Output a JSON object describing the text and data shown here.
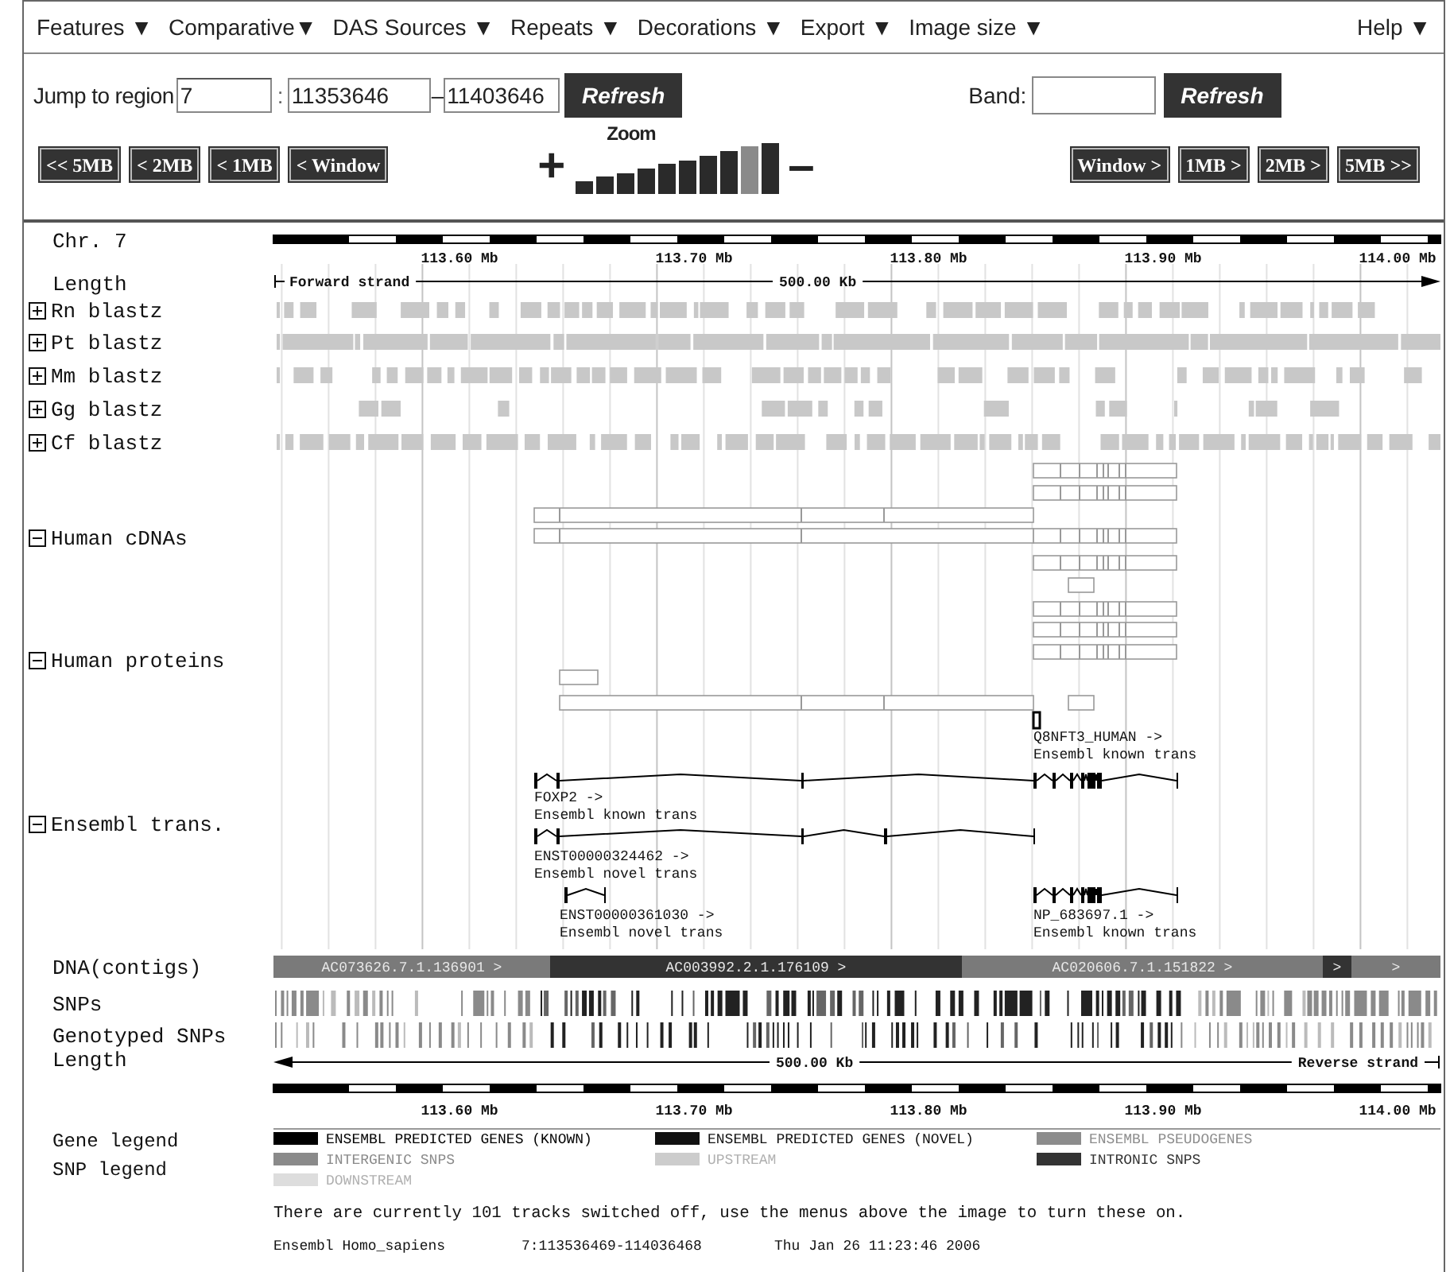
{
  "menus": [
    {
      "label": "Features ▼"
    },
    {
      "label": "Comparative▼"
    },
    {
      "label": "DAS Sources ▼"
    },
    {
      "label": "Repeats ▼"
    },
    {
      "label": "Decorations ▼"
    },
    {
      "label": "Export ▼"
    },
    {
      "label": "Image size ▼"
    }
  ],
  "help_menu": "Help ▼",
  "region": {
    "label": "Jump to region",
    "chromosome": "7",
    "separator": ":",
    "start": "11353646",
    "dash": "–",
    "end": "11403646",
    "button": "Refresh"
  },
  "band": {
    "label": "Band:",
    "button": "Refresh"
  },
  "nav_left": [
    "<< 5MB",
    "< 2MB",
    "< 1MB",
    "< Window"
  ],
  "zoom": {
    "plus": "+",
    "label": "Zoom",
    "minus": "–",
    "levels": [
      {
        "selected": false
      },
      {
        "selected": false
      },
      {
        "selected": false
      },
      {
        "selected": false
      },
      {
        "selected": false
      },
      {
        "selected": false
      },
      {
        "selected": false
      },
      {
        "selected": false
      },
      {
        "selected": true
      },
      {
        "selected": false
      }
    ]
  },
  "nav_right": [
    "Window >",
    "1MB >",
    "2MB >",
    "5MB >>"
  ],
  "scale_top": {
    "title": "Chr. 7",
    "ticks": [
      "113.60 Mb",
      "113.70 Mb",
      "113.80 Mb",
      "113.90 Mb",
      "114.00 Mb"
    ]
  },
  "length_top": {
    "label": "Length",
    "strand": "Forward strand",
    "span": "500.00 Kb"
  },
  "tracks": [
    {
      "label": "Rn blastz",
      "kind": "blastz",
      "expanded": false
    },
    {
      "label": "Pt blastz",
      "kind": "blastz",
      "expanded": false
    },
    {
      "label": "Mm blastz",
      "kind": "blastz",
      "expanded": false
    },
    {
      "label": "Gg blastz",
      "kind": "blastz",
      "expanded": false
    },
    {
      "label": "Cf blastz",
      "kind": "blastz",
      "expanded": false
    },
    {
      "label": "Human cDNAs",
      "kind": "cdna",
      "expanded": true
    },
    {
      "label": "Human proteins",
      "kind": "protein",
      "expanded": true
    },
    {
      "label": "Ensembl trans.",
      "kind": "transcript",
      "expanded": true,
      "features": [
        {
          "name": "Q8NFT3_HUMAN ->",
          "type": "Ensembl known trans"
        },
        {
          "name": "FOXP2 ->",
          "type": "Ensembl known trans"
        },
        {
          "name": "ENST00000324462 ->",
          "type": "Ensembl novel trans"
        },
        {
          "name": "ENST00000361030 ->",
          "type": "Ensembl novel trans"
        },
        {
          "name": "NP_683697.1 ->",
          "type": "Ensembl known trans"
        }
      ]
    }
  ],
  "contigs": {
    "label": "DNA(contigs)",
    "segments": [
      {
        "name": "AC073626.7.1.136901 >",
        "color": "#7a7a7a"
      },
      {
        "name": "AC003992.2.1.176109 >",
        "color": "#333333"
      },
      {
        "name": "AC020606.7.1.151822 >",
        "color": "#7a7a7a"
      },
      {
        "name": ">",
        "color": "#333333"
      },
      {
        "name": ">",
        "color": "#7a7a7a"
      }
    ]
  },
  "snps": {
    "label": "SNPs"
  },
  "genotyped_snps": {
    "label": "Genotyped SNPs"
  },
  "length_bottom": {
    "label": "Length",
    "span": "500.00 Kb",
    "strand": "Reverse strand"
  },
  "scale_bottom": {
    "ticks": [
      "113.60 Mb",
      "113.70 Mb",
      "113.80 Mb",
      "113.90 Mb",
      "114.00 Mb"
    ]
  },
  "legends": [
    {
      "title": "Gene legend",
      "items": [
        {
          "label": "ENSEMBL PREDICTED GENES (KNOWN)",
          "color": "#000000"
        },
        {
          "label": "ENSEMBL PREDICTED GENES (NOVEL)",
          "color": "#111111"
        },
        {
          "label": "ENSEMBL PSEUDOGENES",
          "color": "#8c8c8c"
        }
      ]
    },
    {
      "title": "SNP legend",
      "items": [
        {
          "label": "INTERGENIC SNPS",
          "color": "#8a8a8a"
        },
        {
          "label": "UPSTREAM",
          "color": "#cccccc"
        },
        {
          "label": "INTRONIC SNPS",
          "color": "#333333"
        },
        {
          "label": "DOWNSTREAM",
          "color": "#dddddd"
        }
      ]
    }
  ],
  "notice": "There are currently 101 tracks switched off, use the menus above the image to turn these on.",
  "footer": {
    "species": "Ensembl Homo_sapiens",
    "location": "7:113536469-114036468",
    "date": "Thu Jan 26 11:23:46 2006"
  }
}
